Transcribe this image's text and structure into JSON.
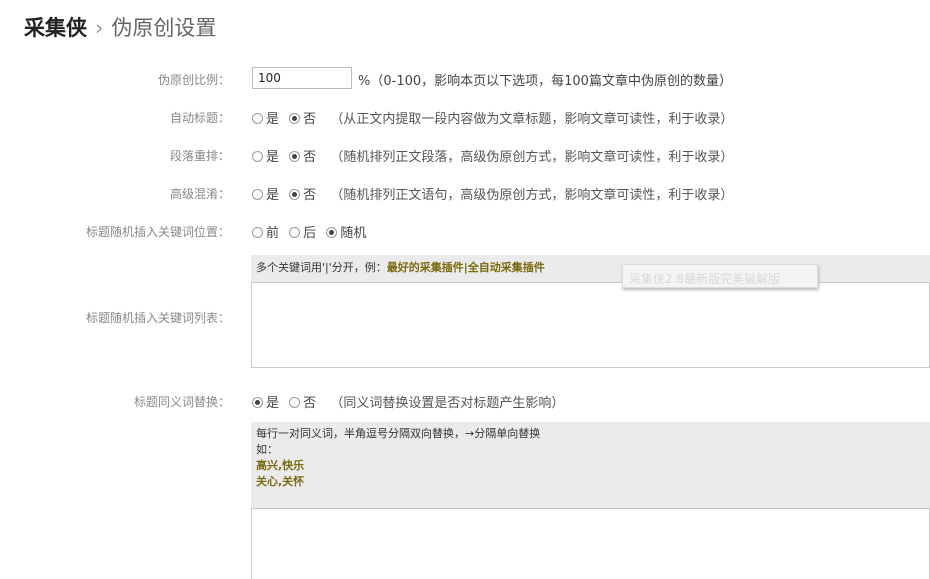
{
  "header": {
    "app_name": "采集侠",
    "separator": "›",
    "page_title": "伪原创设置"
  },
  "form": {
    "ratio": {
      "label": "伪原创比例：",
      "value": "100",
      "hint": "%（0-100，影响本页以下选项，每100篇文章中伪原创的数量）"
    },
    "auto_title": {
      "label": "自动标题：",
      "options": [
        "是",
        "否"
      ],
      "selected": "否",
      "hint": "（从正文内提取一段内容做为文章标题，影响文章可读性，利于收录）"
    },
    "paragraph_shuffle": {
      "label": "段落重排：",
      "options": [
        "是",
        "否"
      ],
      "selected": "否",
      "hint": "（随机排列正文段落，高级伪原创方式，影响文章可读性，利于收录）"
    },
    "advanced_mix": {
      "label": "高级混淆：",
      "options": [
        "是",
        "否"
      ],
      "selected": "否",
      "hint": "（随机排列正文语句，高级伪原创方式，影响文章可读性，利于收录）"
    },
    "keyword_position": {
      "label": "标题随机插入关键词位置：",
      "options": [
        "前",
        "后",
        "随机"
      ],
      "selected": "随机"
    },
    "keyword_list": {
      "label": "标题随机插入关键词列表：",
      "help_prefix": "多个关键词用'|'分开，例：",
      "help_example": "最好的采集插件|全自动采集插件",
      "value": ""
    },
    "watermark_text": "采集侠2.8最新版完美破解版",
    "synonym_replace": {
      "label": "标题同义词替换：",
      "options": [
        "是",
        "否"
      ],
      "selected": "是",
      "hint": "（同义词替换设置是否对标题产生影响）"
    },
    "synonym_list": {
      "help_line1": "每行一对同义词，半角逗号分隔双向替换，→分隔单向替换",
      "help_line2": "如：",
      "example1": "高兴,快乐",
      "example2": "关心,关怀",
      "value": ""
    }
  },
  "colors": {
    "help_background": "#ebebeb",
    "example_highlight": "#7a6a10",
    "label_text": "#888888"
  }
}
